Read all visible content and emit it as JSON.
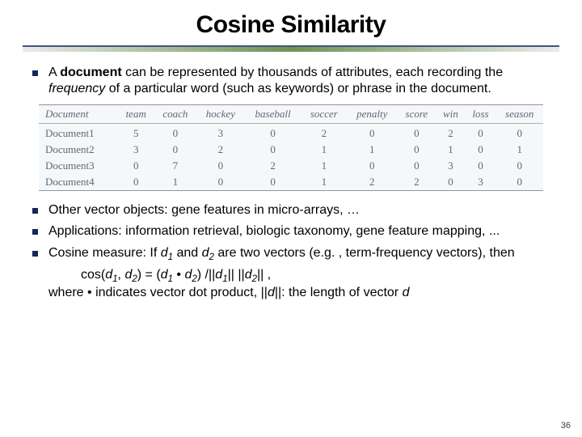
{
  "title": "Cosine Similarity",
  "page_number": "36",
  "bullets_top": {
    "b0": {
      "pre": "A ",
      "bold": "document",
      "mid": " can be represented by thousands of attributes, each recording the ",
      "ital": "frequency",
      "post": " of a particular word (such as keywords) or phrase in the document."
    }
  },
  "table": {
    "headers": [
      "Document",
      "team",
      "coach",
      "hockey",
      "baseball",
      "soccer",
      "penalty",
      "score",
      "win",
      "loss",
      "season"
    ],
    "rows": [
      {
        "label": "Document1",
        "vals": [
          "5",
          "0",
          "3",
          "0",
          "2",
          "0",
          "0",
          "2",
          "0",
          "0"
        ]
      },
      {
        "label": "Document2",
        "vals": [
          "3",
          "0",
          "2",
          "0",
          "1",
          "1",
          "0",
          "1",
          "0",
          "1"
        ]
      },
      {
        "label": "Document3",
        "vals": [
          "0",
          "7",
          "0",
          "2",
          "1",
          "0",
          "0",
          "3",
          "0",
          "0"
        ]
      },
      {
        "label": "Document4",
        "vals": [
          "0",
          "1",
          "0",
          "0",
          "1",
          "2",
          "2",
          "0",
          "3",
          "0"
        ]
      }
    ]
  },
  "bullets_bottom": {
    "b1": "Other vector objects: gene features in micro-arrays, …",
    "b2": "Applications: information retrieval, biologic taxonomy, gene feature mapping, ...",
    "b3_pre": "Cosine measure: If ",
    "b3_d1": "d",
    "b3_s1": "1",
    "b3_and": " and ",
    "b3_d2": "d",
    "b3_s2": "2",
    "b3_post": " are two vectors (e.g. , term-frequency vectors), then"
  },
  "formula": {
    "lhs_cos": "cos(",
    "d": "d",
    "s1": "1",
    "s2": "2",
    "comma": ", ",
    "rparen_eq": ") =  (",
    "dot": " • ",
    "rparen_div": ") /||",
    "pipes_mid": "|| ||",
    "rtail": "|| ,",
    "line2_pre": "where • indicates vector dot product, ||",
    "line2_mid": "d",
    "line2_post": "||: the length of vector ",
    "line2_end": "d"
  }
}
